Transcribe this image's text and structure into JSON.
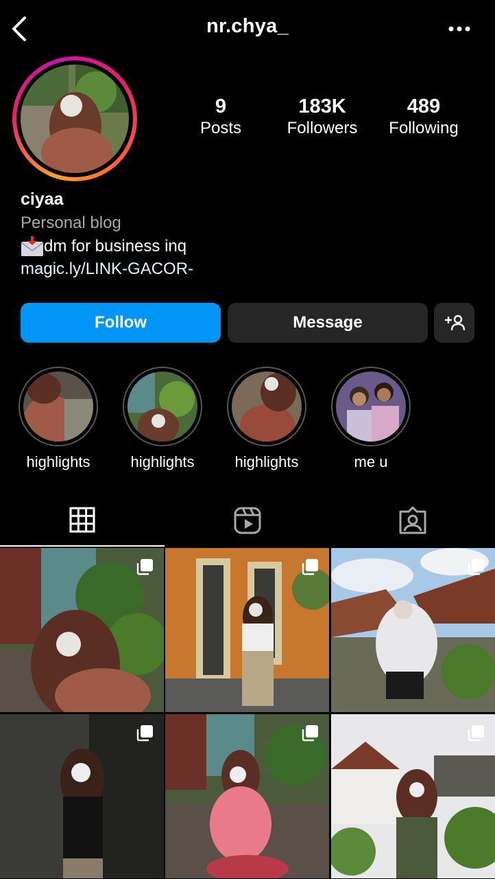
{
  "header": {
    "username": "nr.chya_"
  },
  "profile": {
    "stats": [
      {
        "value": "9",
        "label": "Posts"
      },
      {
        "value": "183K",
        "label": "Followers"
      },
      {
        "value": "489",
        "label": "Following"
      }
    ],
    "name": "ciyaa",
    "category": "Personal blog",
    "bio": "dm for business inq",
    "link": "magic.ly/LINK-GACOR-"
  },
  "actions": {
    "follow": "Follow",
    "message": "Message"
  },
  "highlights": [
    {
      "label": "highlights"
    },
    {
      "label": "highlights"
    },
    {
      "label": "highlights"
    },
    {
      "label": "me u"
    }
  ],
  "colors": {
    "follow_button": "#0095f6",
    "secondary_button": "#262626",
    "background": "#000000",
    "link": "#e0f1ff"
  },
  "icons": [
    "back-icon",
    "more-icon",
    "envelope-icon",
    "add-person-icon",
    "grid-icon",
    "reels-icon",
    "tagged-icon",
    "multiple-photos-icon"
  ]
}
